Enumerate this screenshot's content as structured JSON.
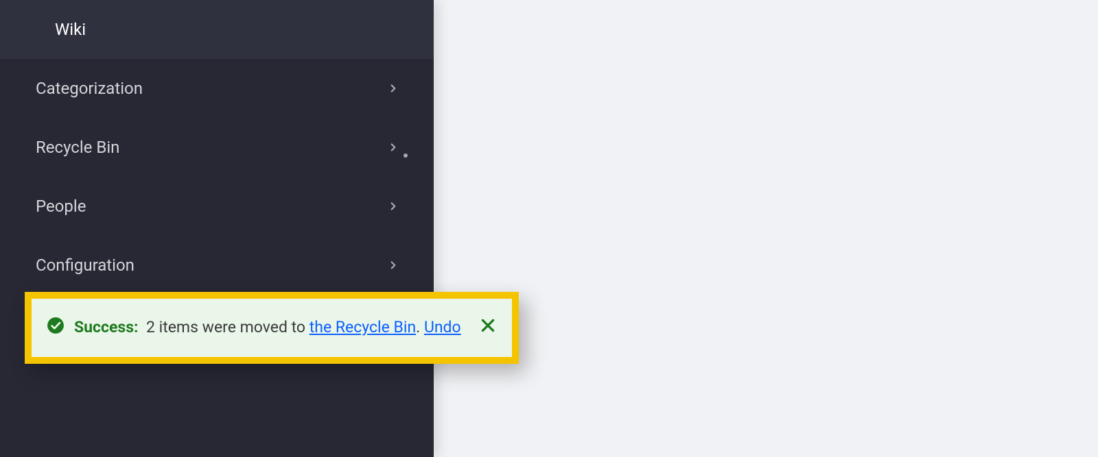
{
  "sidebar": {
    "items": [
      {
        "label": "Wiki",
        "active": true,
        "chevron": false,
        "dot": false
      },
      {
        "label": "Categorization",
        "active": false,
        "chevron": true,
        "dot": false
      },
      {
        "label": "Recycle Bin",
        "active": false,
        "chevron": true,
        "dot": true
      },
      {
        "label": "People",
        "active": false,
        "chevron": true,
        "dot": false
      },
      {
        "label": "Configuration",
        "active": false,
        "chevron": true,
        "dot": false
      }
    ]
  },
  "toast": {
    "heading": "Success:",
    "message_prefix": "2 items were moved to ",
    "link1": "the Recycle Bin",
    "separator": ". ",
    "link2": "Undo"
  }
}
